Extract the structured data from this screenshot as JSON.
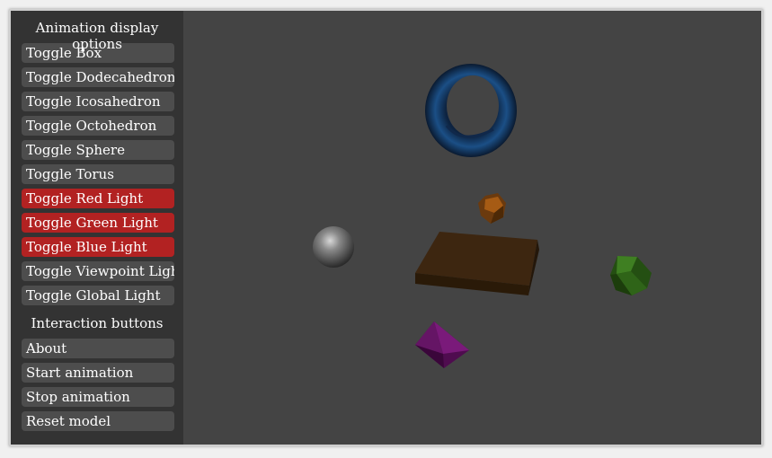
{
  "sidebar": {
    "display_title": "Animation display options",
    "display_buttons": [
      {
        "label": "Toggle Box",
        "active": false
      },
      {
        "label": "Toggle Dodecahedron",
        "active": false
      },
      {
        "label": "Toggle Icosahedron",
        "active": false
      },
      {
        "label": "Toggle Octohedron",
        "active": false
      },
      {
        "label": "Toggle Sphere",
        "active": false
      },
      {
        "label": "Toggle Torus",
        "active": false
      },
      {
        "label": "Toggle Red Light",
        "active": true
      },
      {
        "label": "Toggle Green Light",
        "active": true
      },
      {
        "label": "Toggle Blue Light",
        "active": true
      },
      {
        "label": "Toggle Viewpoint Light",
        "active": false
      },
      {
        "label": "Toggle Global Light",
        "active": false
      }
    ],
    "interaction_title": "Interaction buttons",
    "interaction_buttons": [
      {
        "label": "About"
      },
      {
        "label": "Start animation"
      },
      {
        "label": "Stop animation"
      },
      {
        "label": "Reset model"
      }
    ]
  },
  "colors": {
    "sidebar_bg": "#333333",
    "button_bg": "#4d4d4d",
    "button_active_bg": "#b22222",
    "canvas_bg": "#444444"
  },
  "scene": {
    "objects": [
      "torus",
      "dodecahedron",
      "sphere",
      "box",
      "icosahedron",
      "octahedron"
    ]
  }
}
